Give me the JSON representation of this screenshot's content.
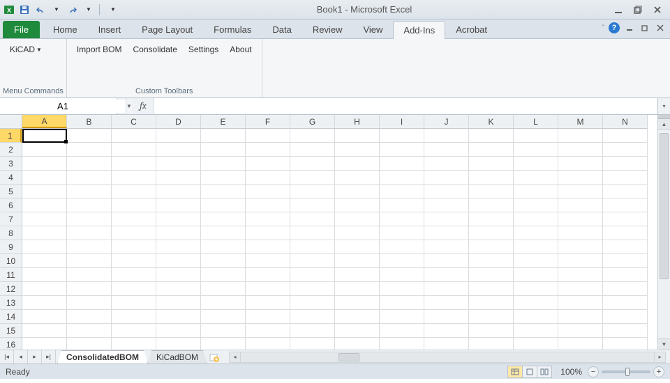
{
  "title": "Book1  -  Microsoft Excel",
  "qat": {
    "save": "Save",
    "undo": "Undo",
    "redo": "Redo"
  },
  "window": {
    "min": "Minimize",
    "max": "Restore",
    "close": "Close"
  },
  "ribbon_tabs": {
    "file": "File",
    "items": [
      "Home",
      "Insert",
      "Page Layout",
      "Formulas",
      "Data",
      "Review",
      "View",
      "Add-Ins",
      "Acrobat"
    ],
    "active": "Add-Ins"
  },
  "ribbon_right": {
    "minimize_ribbon": "▲",
    "help": "?",
    "doc_min": "–",
    "doc_restore": "❐",
    "doc_close": "✕"
  },
  "ribbon": {
    "groups": [
      {
        "label": "Menu Commands",
        "items": [
          {
            "text": "KiCAD",
            "dropdown": true
          }
        ]
      },
      {
        "label": "Custom Toolbars",
        "items": [
          {
            "text": "Import BOM"
          },
          {
            "text": "Consolidate"
          },
          {
            "text": "Settings"
          },
          {
            "text": "About"
          }
        ]
      }
    ]
  },
  "namebox": "A1",
  "formula": "",
  "fx_label": "fx",
  "grid": {
    "columns": [
      "A",
      "B",
      "C",
      "D",
      "E",
      "F",
      "G",
      "H",
      "I",
      "J",
      "K",
      "L",
      "M",
      "N"
    ],
    "rows": [
      1,
      2,
      3,
      4,
      5,
      6,
      7,
      8,
      9,
      10,
      11,
      12,
      13,
      14,
      15,
      16
    ],
    "active_col": "A",
    "active_row": 1
  },
  "sheets": {
    "tabs": [
      "ConsolidatedBOM",
      "KiCadBOM"
    ],
    "active": "ConsolidatedBOM"
  },
  "status": {
    "text": "Ready",
    "zoom": "100%"
  },
  "colors": {
    "accent_green": "#1f8a3b",
    "select_yellow": "#ffd867"
  }
}
